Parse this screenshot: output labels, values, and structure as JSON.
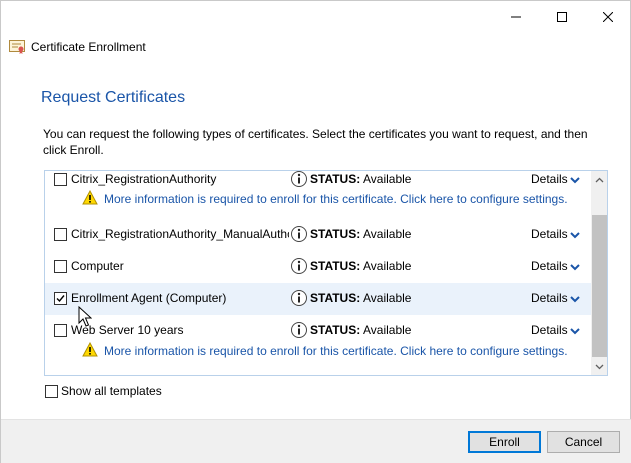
{
  "window": {
    "title": "Certificate Enrollment",
    "app_icon": "certificate-icon",
    "controls": [
      "minimize-icon",
      "maximize-icon",
      "close-icon"
    ]
  },
  "page": {
    "title": "Request Certificates",
    "description": "You can request the following types of certificates. Select the certificates you want to request, and then click Enroll."
  },
  "certificates": [
    {
      "name": "Citrix_RegistrationAuthority",
      "checked": false,
      "status_label": "STATUS:",
      "status_value": "Available",
      "details_label": "Details",
      "warning": "More information is required to enroll for this certificate. Click here to configure settings."
    },
    {
      "name": "Citrix_RegistrationAuthority_ManualAuthorization",
      "checked": false,
      "status_label": "STATUS:",
      "status_value": "Available",
      "details_label": "Details"
    },
    {
      "name": "Computer",
      "checked": false,
      "status_label": "STATUS:",
      "status_value": "Available",
      "details_label": "Details"
    },
    {
      "name": "Enrollment Agent (Computer)",
      "checked": true,
      "status_label": "STATUS:",
      "status_value": "Available",
      "details_label": "Details"
    },
    {
      "name": "Web Server 10 years",
      "checked": false,
      "status_label": "STATUS:",
      "status_value": "Available",
      "details_label": "Details",
      "warning": "More information is required to enroll for this certificate. Click here to configure settings."
    }
  ],
  "show_all": {
    "label": "Show all templates",
    "checked": false
  },
  "buttons": {
    "enroll": "Enroll",
    "cancel": "Cancel"
  },
  "colors": {
    "accent_text": "#1a55a8",
    "selected_row": "#eaf2fb",
    "default_button_border": "#0078d7"
  }
}
